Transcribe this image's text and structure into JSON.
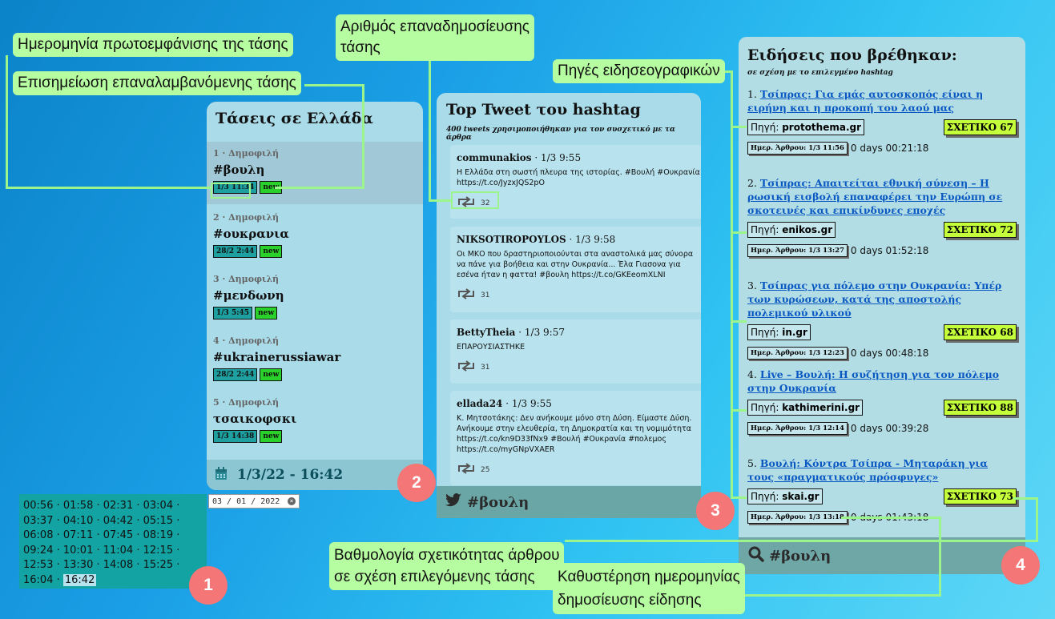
{
  "callouts": {
    "first_seen": "Ημερομηνία πρωτοεμφάνισης της τάσης",
    "repeated": "Επισημείωση επαναλαμβανόμενης τάσης",
    "retweets_1": "Αριθμός επαναδημοσίευσης",
    "retweets_2": "τάσης",
    "sources": "Πηγές ειδησεογραφικών",
    "score_1": "Βαθμολογία σχετικότητας άρθρου",
    "score_2": "σε σχέση επιλεγόμενης τάσης",
    "delay_1": "Καθυστέρηση ημερομηνίας",
    "delay_2": "δημοσίευσης είδησης"
  },
  "markers": [
    "1",
    "2",
    "3",
    "4"
  ],
  "trends": {
    "title": "Τάσεις σε Ελλάδα",
    "items": [
      {
        "meta": "1 · Δημοφιλή",
        "tag": "#βουλη",
        "date": "1/3 11:34",
        "new": "new"
      },
      {
        "meta": "2 · Δημοφιλή",
        "tag": "#ουκρανια",
        "date": "28/2 2:44",
        "new": "new"
      },
      {
        "meta": "3 · Δημοφιλή",
        "tag": "#μενδωνη",
        "date": "1/3 5:45",
        "new": "new"
      },
      {
        "meta": "4 · Δημοφιλή",
        "tag": "#ukrainerussiawar",
        "date": "28/2 2:44",
        "new": "new"
      },
      {
        "meta": "5 · Δημοφιλή",
        "tag": "τσαικοφσκι",
        "date": "1/3 14:38",
        "new": "new"
      }
    ],
    "footer_datetime": "1/3/22 - 16:42"
  },
  "times": [
    "00:56",
    "01:58",
    "02:31",
    "03:04",
    "03:37",
    "04:10",
    "04:42",
    "05:15",
    "06:08",
    "07:11",
    "07:45",
    "08:19",
    "09:24",
    "10:01",
    "11:04",
    "12:15",
    "12:53",
    "13:30",
    "14:08",
    "15:25",
    "16:04",
    "16:42"
  ],
  "selected_time": "16:42",
  "date_input": {
    "value": "03 / 01 / 2022"
  },
  "tweets": {
    "title": "Top Tweet του hashtag",
    "subtitle": "400 tweets χρησιμοποιήθηκαν για τον συσχετικό με τα άρθρα",
    "items": [
      {
        "user": "communakios",
        "time": " · 1/3 9:55",
        "text": "Η Ελλάδα στη σωστή πλευρα της ιστορίας. #Βουλή #Ουκρανία https://t.co/JyzxJQS2pO",
        "retweets": "32"
      },
      {
        "user": "NIKSOTIROPOYLOS",
        "time": " · 1/3 9:58",
        "text": "Οι ΜΚΟ που δραστηριοποιούνται στα αναστολικά μας σύνορα να πάνε για βοήθεια και στην Ουκρανία... Έλα Γιασονα για εσένα ήταν η φαττα! #βουλη https://t.co/GKEeomXLNI",
        "retweets": "31"
      },
      {
        "user": "BettyTheia",
        "time": " · 1/3 9:57",
        "text": "ΕΠΑΡΟΥΣΙΑΣΤΗΚΕ",
        "retweets": "31"
      },
      {
        "user": "ellada24",
        "time": " · 1/3 9:55",
        "text": "Κ. Μητσοτάκης: Δεν ανήκουμε μόνο στη Δύση. Είμαστε Δύση. Ανήκουμε στην ελευθερία, τη Δημοκρατία και τη νομιμότητα https://t.co/kn9D33fNx9 #Βουλή #Ουκρανία #πολεμος https://t.co/myGNpVXAER",
        "retweets": "25"
      }
    ],
    "footer_tag": "#βουλη"
  },
  "news": {
    "title": "Ειδήσεις που βρέθηκαν:",
    "subtitle": "σε σχέση με το επιλεγμένο hashtag",
    "source_label": "Πηγή: ",
    "articles": [
      {
        "num": "1. ",
        "title": "Τσίπρας: Για εμάς αυτοσκοπός είναι η ειρήνη και η προκοπή του λαού μας",
        "source": "protothema.gr",
        "relevance": "ΣΧΕΤΙΚΟ 67",
        "date": "Ημερ. Άρθρου: 1/3 11:56",
        "delay": "0 days 00:21:18"
      },
      {
        "num": "2. ",
        "title": "Τσίπρας: Απαιτείται εθνική σύνεση – Η ρωσική εισβολή επαναφέρει την Ευρώπη σε σκοτεινές και επικίνδυνες εποχές",
        "source": "enikos.gr",
        "relevance": "ΣΧΕΤΙΚΟ 72",
        "date": "Ημερ. Άρθρου: 1/3 13:27",
        "delay": "0 days 01:52:18"
      },
      {
        "num": "3. ",
        "title": "Τσίπρας για πόλεμο στην Ουκρανία: Υπέρ των κυρώσεων, κατά της αποστολής πολεμικού υλικού",
        "source": "in.gr",
        "relevance": "ΣΧΕΤΙΚΟ 68",
        "date": "Ημερ. Άρθρου: 1/3 12:23",
        "delay": "0 days 00:48:18"
      },
      {
        "num": "4. ",
        "title": "Live – Βουλή: Η συζήτηση για τον πόλεμο στην Ουκρανία",
        "source": "kathimerini.gr",
        "relevance": "ΣΧΕΤΙΚΟ 88",
        "date": "Ημερ. Άρθρου: 1/3 12:14",
        "delay": "0 days 00:39:28"
      },
      {
        "num": "5. ",
        "title": "Βουλή: Κόντρα Τσίπρα - Μηταράκη για τους «πραγματικούς πρόσφυγες»",
        "source": "skai.gr",
        "relevance": "ΣΧΕΤΙΚΟ 73",
        "date": "Ημερ. Άρθρου: 1/3 13:18",
        "delay": "0 days 01:43:18"
      }
    ],
    "footer_tag": "#βουλη"
  },
  "colors": {
    "callout": "#b6fca0",
    "relevance": "#c5ff3b",
    "new_badge": "#2ad12a",
    "link": "#0a58c2",
    "marker": "#f47676"
  }
}
